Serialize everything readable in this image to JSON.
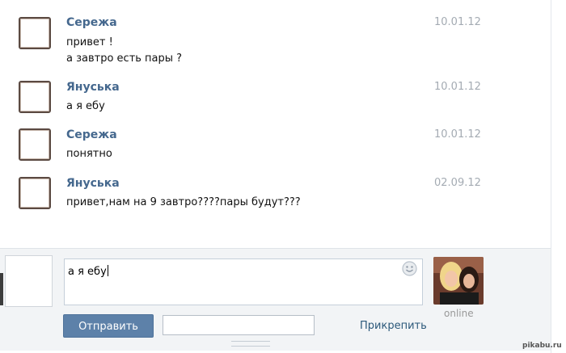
{
  "messages": [
    {
      "author": "Сережа",
      "date": "10.01.12",
      "lines": [
        "привет !",
        "а завтро есть пары ?"
      ]
    },
    {
      "author": "Януська",
      "date": "10.01.12",
      "lines": [
        "а я ебу"
      ]
    },
    {
      "author": "Сережа",
      "date": "10.01.12",
      "lines": [
        "понятно"
      ]
    },
    {
      "author": "Януська",
      "date": "02.09.12",
      "lines": [
        "привет,нам на 9 завтро????пары будут???"
      ]
    }
  ],
  "composer": {
    "text": "а я ебу",
    "send_label": "Отправить",
    "attach_label": "Прикрепить",
    "emoji_icon": "smiley-icon"
  },
  "peer": {
    "status": "online"
  },
  "watermark": "pikabu.ru",
  "colors": {
    "author": "#45688e",
    "button": "#5d81a9",
    "date": "#a4abb3",
    "link": "#2b587a"
  }
}
